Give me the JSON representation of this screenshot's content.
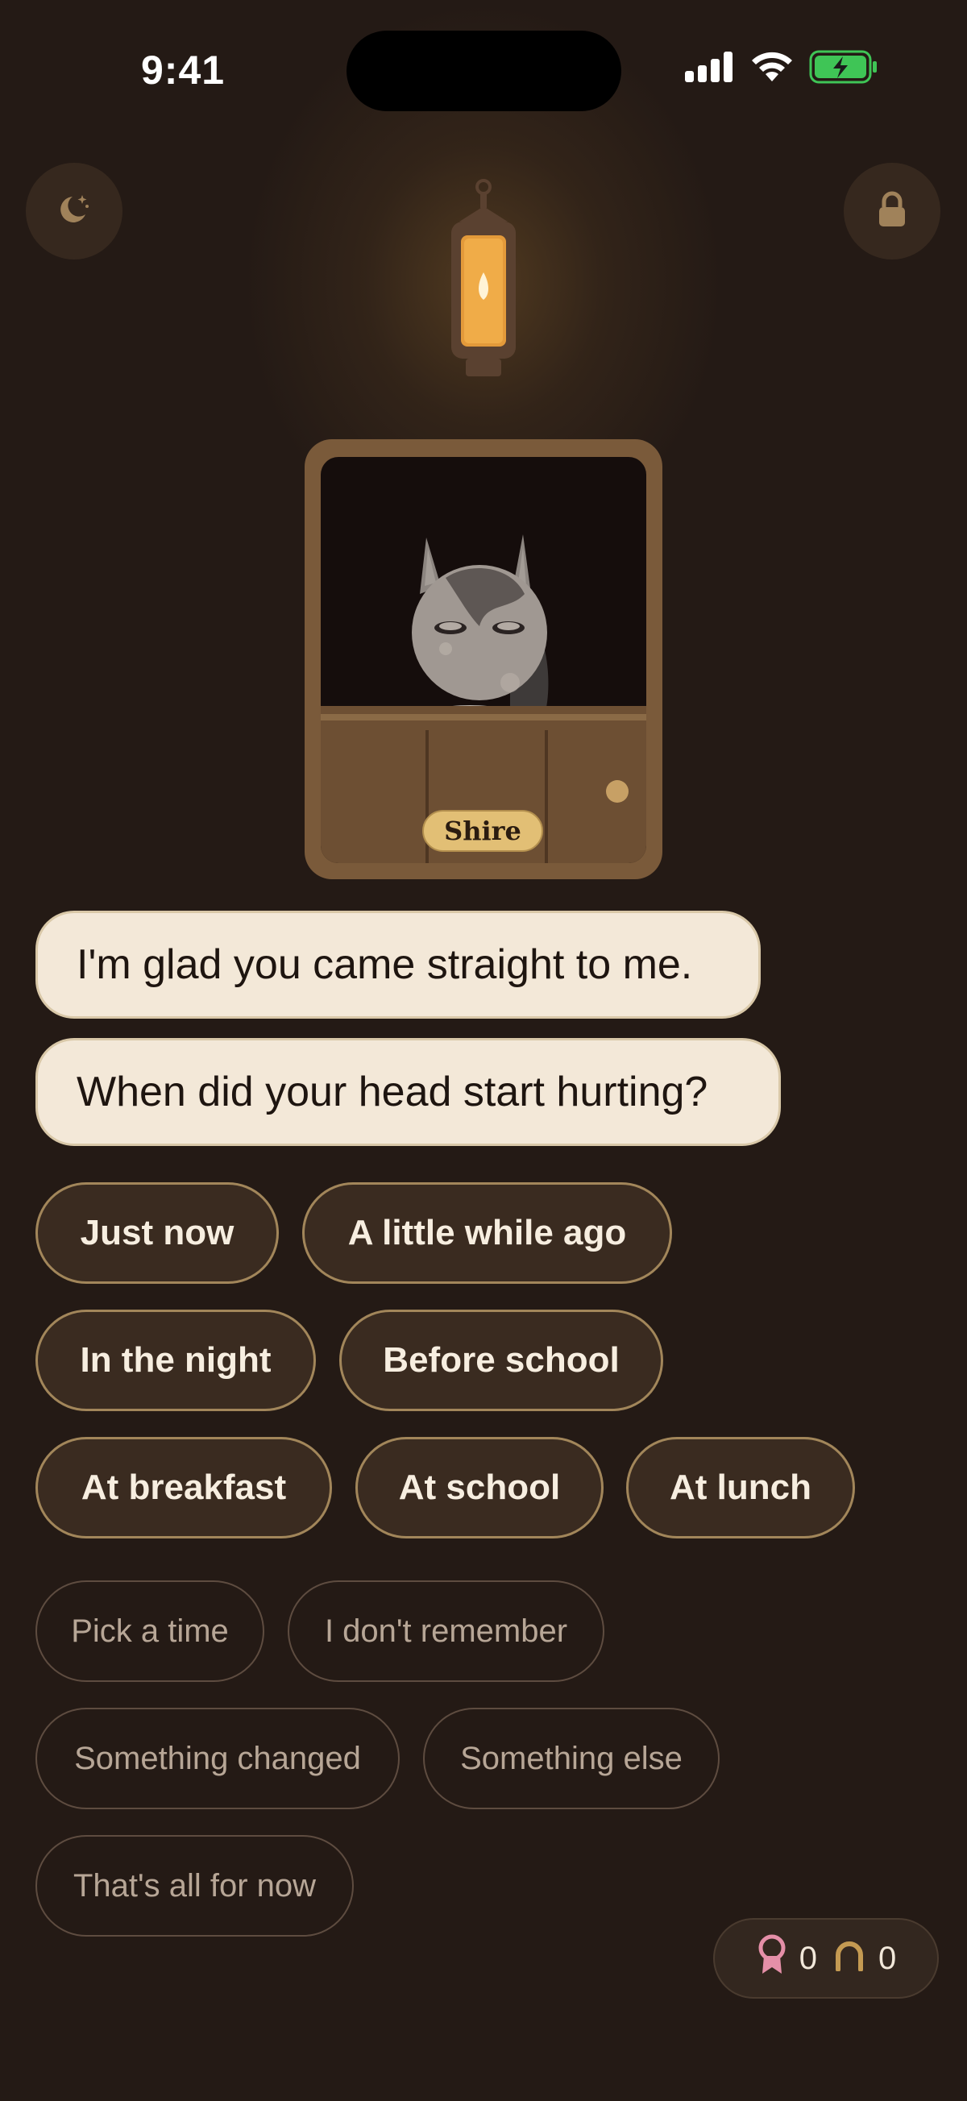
{
  "status_bar": {
    "time": "9:41",
    "icons": [
      "cellular-signal-icon",
      "wifi-icon",
      "battery-charging-icon"
    ]
  },
  "header": {
    "left_button_icon": "moon-stars-icon",
    "right_button_icon": "lock-icon"
  },
  "character": {
    "name": "Shire"
  },
  "messages": [
    "I'm glad you came straight to me.",
    "When did your head start hurting?"
  ],
  "choices": {
    "primary": [
      "Just now",
      "A little while ago",
      "In the night",
      "Before school",
      "At breakfast",
      "At school",
      "At lunch"
    ],
    "secondary": [
      "Pick a time",
      "I don't remember",
      "Something changed",
      "Something else",
      "That's all for now"
    ]
  },
  "score": {
    "ribbons": "0",
    "horseshoes": "0"
  },
  "colors": {
    "background": "#241a15",
    "bubble": "#f3e8d8",
    "chip_border": "#a2865a",
    "accent_gold": "#e2bf75",
    "battery_green": "#3fc556",
    "ribbon_pink": "#e58fa8"
  }
}
